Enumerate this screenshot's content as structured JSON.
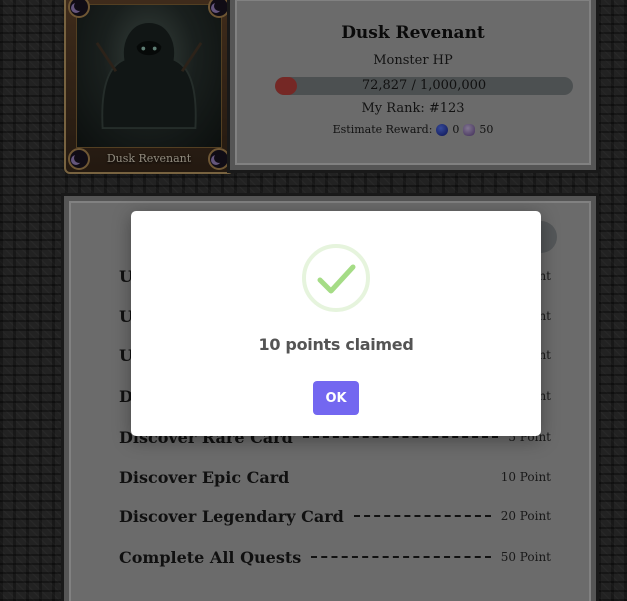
{
  "boss": {
    "card_name": "Dusk Revenant",
    "title": "Dusk Revenant",
    "hp_label": "Monster HP",
    "hp_text": "72,827 / 1,000,000",
    "hp_fraction": 0.072827,
    "rank": "My Rank: #123",
    "reward_label": "Estimate Reward:",
    "reward_blue_value": "0",
    "reward_purple_value": "50",
    "reward_blue_icon": "blue-gem-icon",
    "reward_purple_icon": "purple-gem-icon"
  },
  "quests": [
    {
      "label": "U",
      "points": "Point"
    },
    {
      "label": "U",
      "points": "Point"
    },
    {
      "label": "U",
      "points": "Point"
    },
    {
      "label": "D",
      "points": "Point"
    },
    {
      "label": "Discover Rare Card",
      "points": "5 Point"
    },
    {
      "label": "Discover Epic Card",
      "points": "10 Point"
    },
    {
      "label": "Discover Legendary Card",
      "points": "20 Point"
    },
    {
      "label": "Complete All Quests",
      "points": "50 Point"
    }
  ],
  "dialog": {
    "title": "10 points claimed",
    "ok_label": "OK",
    "icon": "success-check-icon"
  },
  "colors": {
    "accent": "#7367f0",
    "success": "#a5dc86",
    "hp_fill": "#c4443e",
    "panel_bg": "#b3b3b3"
  }
}
